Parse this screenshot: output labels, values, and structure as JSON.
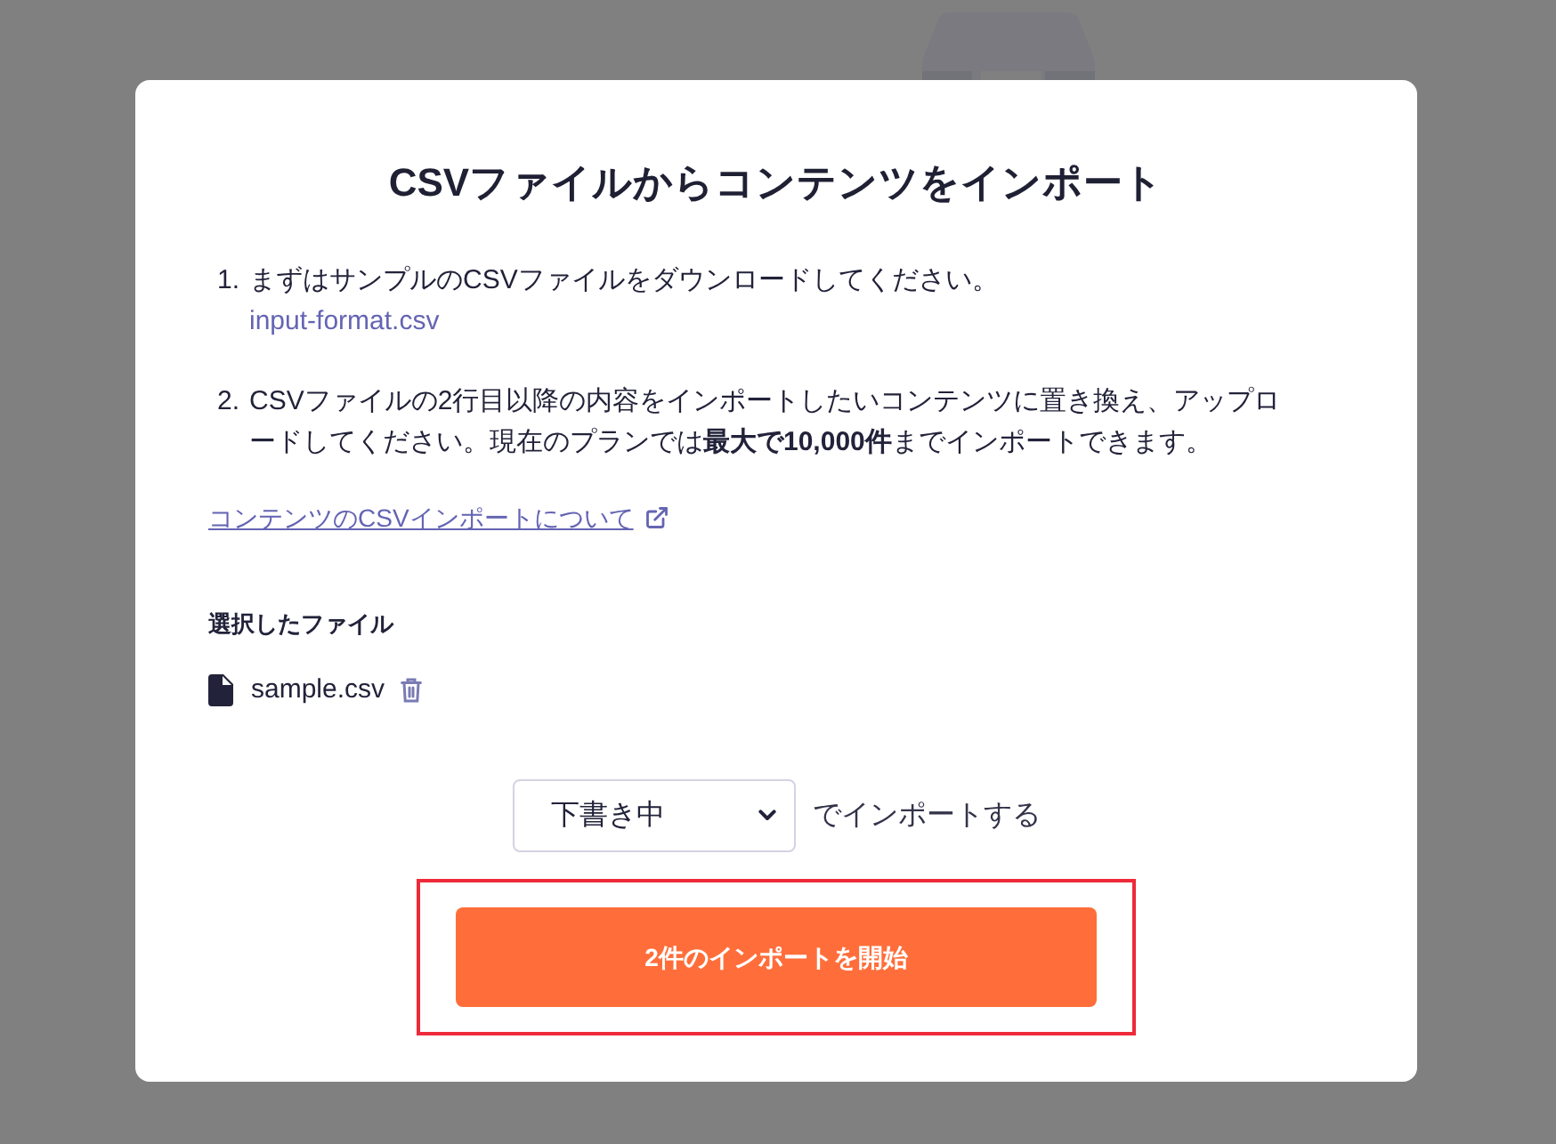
{
  "modal": {
    "title": "CSVファイルからコンテンツをインポート",
    "steps": [
      {
        "number": "1.",
        "text": "まずはサンプルのCSVファイルをダウンロードしてください。",
        "link": "input-format.csv"
      },
      {
        "number": "2.",
        "text": "CSVファイルの2行目以降の内容をインポートしたいコンテンツに置き換え、アップロードしてください。現在のプランでは**最大で10,000件**までインポートできます。"
      }
    ],
    "help_link": "コンテンツのCSVインポートについて",
    "selected_file": {
      "label": "選択したファイル",
      "file_name": "sample.csv"
    },
    "status_select": {
      "value": "下書き中",
      "suffix": "でインポートする"
    },
    "start_button": {
      "label": "2件のインポートを開始",
      "highlighted": true
    }
  }
}
